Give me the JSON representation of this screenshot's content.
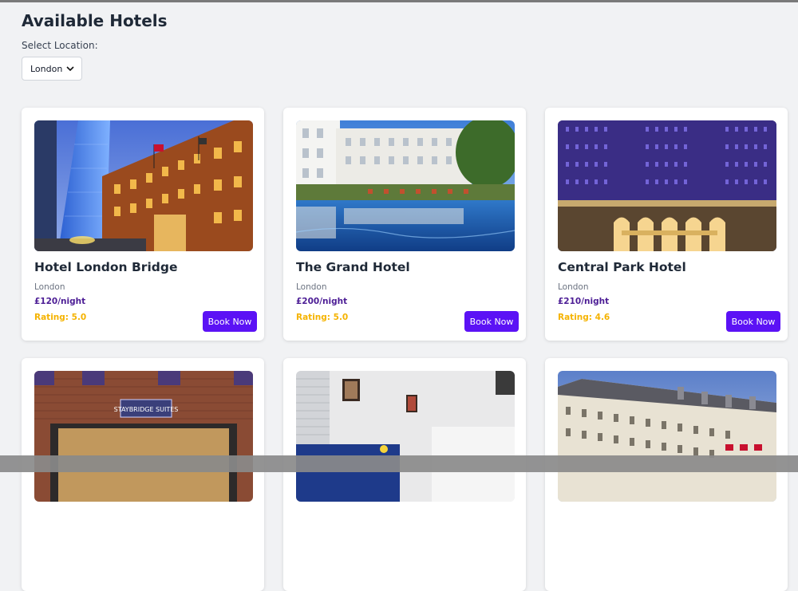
{
  "page": {
    "title": "Available Hotels",
    "location_label": "Select Location:",
    "location_value": "London"
  },
  "hotels": [
    {
      "name": "Hotel London Bridge",
      "city": "London",
      "price": "£120/night",
      "rating": "Rating: 5.0",
      "book_label": "Book Now"
    },
    {
      "name": "The Grand Hotel",
      "city": "London",
      "price": "£200/night",
      "rating": "Rating: 5.0",
      "book_label": "Book Now"
    },
    {
      "name": "Central Park Hotel",
      "city": "London",
      "price": "£210/night",
      "rating": "Rating: 4.6",
      "book_label": "Book Now"
    },
    {
      "name": "",
      "city": "",
      "price": "",
      "rating": "",
      "book_label": ""
    },
    {
      "name": "",
      "city": "",
      "price": "",
      "rating": "",
      "book_label": ""
    },
    {
      "name": "",
      "city": "",
      "price": "",
      "rating": "",
      "book_label": ""
    }
  ],
  "photo_sign": "STAYBRIDGE SUITES",
  "colors": {
    "accent": "#5b12f5",
    "price": "#4c1d95",
    "rating": "#f5b301",
    "background": "#f1f2f4"
  }
}
